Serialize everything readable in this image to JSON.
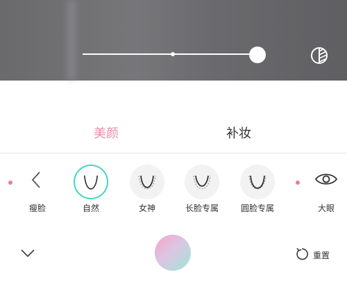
{
  "slider": {
    "value": 1.0
  },
  "tabs": [
    {
      "label": "美颜",
      "active": true
    },
    {
      "label": "补妆",
      "active": false
    }
  ],
  "colors": {
    "accent": "#e88fae",
    "selected_ring": "#41d6c3",
    "dot": "#ea7a98"
  },
  "face_options": {
    "slim_face_label": "瘦脸",
    "items": [
      {
        "label": "自然",
        "selected": true,
        "icon": "face-natural-icon"
      },
      {
        "label": "女神",
        "selected": false,
        "icon": "face-goddess-icon"
      },
      {
        "label": "长脸专属",
        "selected": false,
        "icon": "face-long-icon"
      },
      {
        "label": "圆脸专属",
        "selected": false,
        "icon": "face-round-icon"
      }
    ],
    "big_eyes_label": "大眼"
  },
  "bottom_bar": {
    "reset_label": "重置"
  }
}
